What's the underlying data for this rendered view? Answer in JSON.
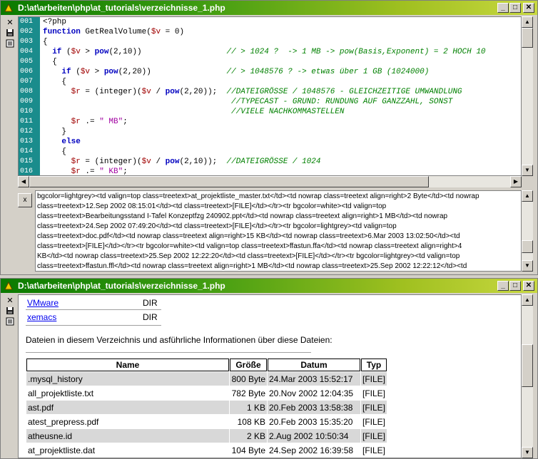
{
  "top_window": {
    "title": "D:\\at\\arbeiten\\php\\at_tutorials\\verzeichnisse_1.php",
    "controls": {
      "minimize": "_",
      "maximize": "□",
      "close": "✕"
    }
  },
  "code_lines": [
    {
      "n": "001",
      "parts": [
        {
          "c": "op",
          "t": "<?php"
        }
      ]
    },
    {
      "n": "002",
      "parts": [
        {
          "c": "kw",
          "t": "function"
        },
        {
          "c": "op",
          "t": " GetRealVolume("
        },
        {
          "c": "var",
          "t": "$v"
        },
        {
          "c": "op",
          "t": " = 0)"
        }
      ]
    },
    {
      "n": "003",
      "parts": [
        {
          "c": "op",
          "t": "{"
        }
      ]
    },
    {
      "n": "004",
      "parts": [
        {
          "c": "op",
          "t": "  "
        },
        {
          "c": "kw",
          "t": "if"
        },
        {
          "c": "op",
          "t": " ("
        },
        {
          "c": "var",
          "t": "$v"
        },
        {
          "c": "op",
          "t": " > "
        },
        {
          "c": "kw",
          "t": "pow"
        },
        {
          "c": "op",
          "t": "(2,10))                  "
        },
        {
          "c": "cm",
          "t": "// > 1024 ?  -> 1 MB -> pow(Basis,Exponent) = 2 HOCH 10"
        }
      ]
    },
    {
      "n": "005",
      "parts": [
        {
          "c": "op",
          "t": "  {"
        }
      ]
    },
    {
      "n": "006",
      "parts": [
        {
          "c": "op",
          "t": "    "
        },
        {
          "c": "kw",
          "t": "if"
        },
        {
          "c": "op",
          "t": " ("
        },
        {
          "c": "var",
          "t": "$v"
        },
        {
          "c": "op",
          "t": " > "
        },
        {
          "c": "kw",
          "t": "pow"
        },
        {
          "c": "op",
          "t": "(2,20))                "
        },
        {
          "c": "cm",
          "t": "// > 1048576 ? -> etwas über 1 GB (1024000)"
        }
      ]
    },
    {
      "n": "007",
      "parts": [
        {
          "c": "op",
          "t": "    {"
        }
      ]
    },
    {
      "n": "008",
      "parts": [
        {
          "c": "op",
          "t": "      "
        },
        {
          "c": "var",
          "t": "$r"
        },
        {
          "c": "op",
          "t": " = (integer)("
        },
        {
          "c": "var",
          "t": "$v"
        },
        {
          "c": "op",
          "t": " / "
        },
        {
          "c": "kw",
          "t": "pow"
        },
        {
          "c": "op",
          "t": "(2,20));  "
        },
        {
          "c": "cm",
          "t": "//DATEIGRÖSSE / 1048576 - GLEICHZEITIGE UMWANDLUNG"
        }
      ]
    },
    {
      "n": "009",
      "parts": [
        {
          "c": "op",
          "t": "                                        "
        },
        {
          "c": "cm",
          "t": "//TYPECAST - GRUND: RUNDUNG AUF GANZZAHL, SONST"
        }
      ]
    },
    {
      "n": "010",
      "parts": [
        {
          "c": "op",
          "t": "                                        "
        },
        {
          "c": "cm",
          "t": "//VIELE NACHKOMMASTELLEN"
        }
      ]
    },
    {
      "n": "011",
      "parts": [
        {
          "c": "op",
          "t": "      "
        },
        {
          "c": "var",
          "t": "$r"
        },
        {
          "c": "op",
          "t": " .= "
        },
        {
          "c": "str",
          "t": "\" MB\""
        },
        {
          "c": "op",
          "t": ";"
        }
      ]
    },
    {
      "n": "012",
      "parts": [
        {
          "c": "op",
          "t": "    }"
        }
      ]
    },
    {
      "n": "013",
      "parts": [
        {
          "c": "op",
          "t": "    "
        },
        {
          "c": "kw",
          "t": "else"
        }
      ]
    },
    {
      "n": "014",
      "parts": [
        {
          "c": "op",
          "t": "    {"
        }
      ]
    },
    {
      "n": "015",
      "parts": [
        {
          "c": "op",
          "t": "      "
        },
        {
          "c": "var",
          "t": "$r"
        },
        {
          "c": "op",
          "t": " = (integer)("
        },
        {
          "c": "var",
          "t": "$v"
        },
        {
          "c": "op",
          "t": " / "
        },
        {
          "c": "kw",
          "t": "pow"
        },
        {
          "c": "op",
          "t": "(2,10));  "
        },
        {
          "c": "cm",
          "t": "//DATEIGRÖSSE / 1024"
        }
      ]
    },
    {
      "n": "016",
      "parts": [
        {
          "c": "op",
          "t": "      "
        },
        {
          "c": "var",
          "t": "$r"
        },
        {
          "c": "op",
          "t": " .= "
        },
        {
          "c": "str",
          "t": "\" KB\""
        },
        {
          "c": "op",
          "t": ";"
        }
      ]
    }
  ],
  "output_close_label": "x",
  "output_lines": [
    "bgcolor=lightgrey><td valign=top class=treetext>at_projektliste_master.txt</td><td nowrap class=treetext align=right>2 Byte</td><td nowrap",
    "class=treetext>12.Sep 2002 08:15:01</td><td class=treetext>[FILE]</td></tr><tr bgcolor=white><td valign=top",
    "class=treetext>Bearbeitungsstand I-Tafel Konzeptfzg 240902.ppt</td><td nowrap class=treetext align=right>1 MB</td><td nowrap",
    "class=treetext>24.Sep 2002 07:49:20</td><td class=treetext>[FILE]</td></tr><tr bgcolor=lightgrey><td valign=top",
    "class=treetext>doc.pdf</td><td nowrap class=treetext align=right>15 KB</td><td nowrap class=treetext>6.Mar 2003 13:02:50</td><td",
    "class=treetext>[FILE]</td></tr><tr bgcolor=white><td valign=top class=treetext>ffastun.ffa</td><td nowrap class=treetext align=right>4",
    "KB</td><td nowrap class=treetext>25.Sep 2002 12:22:20</td><td class=treetext>[FILE]</td></tr><tr bgcolor=lightgrey><td valign=top",
    "class=treetext>ffastun.ffl</td><td nowrap class=treetext align=right>1 MB</td><td nowrap class=treetext>25.Sep 2002 12:22:12</td><td"
  ],
  "bottom_window": {
    "title": "D:\\at\\arbeiten\\php\\at_tutorials\\verzeichnisse_1.php",
    "controls": {
      "minimize": "_",
      "maximize": "□",
      "close": "✕"
    },
    "dirs": [
      {
        "name": "VMware",
        "type": "DIR"
      },
      {
        "name": "xemacs",
        "type": "DIR"
      }
    ],
    "info_text": "Dateien in diesem Verzeichnis und asführliche Informationen über diese Dateien:",
    "table_headers": {
      "name": "Name",
      "size": "Größe",
      "date": "Datum",
      "type": "Typ"
    },
    "files": [
      {
        "name": ".mysql_history",
        "size": "800 Byte",
        "date": "24.Mar 2003 15:52:17",
        "type": "[FILE]"
      },
      {
        "name": "all_projektliste.txt",
        "size": "782 Byte",
        "date": "20.Nov 2002 12:04:35",
        "type": "[FILE]"
      },
      {
        "name": "ast.pdf",
        "size": "1 KB",
        "date": "20.Feb 2003 13:58:38",
        "type": "[FILE]"
      },
      {
        "name": "atest_prepress.pdf",
        "size": "108 KB",
        "date": "20.Feb 2003 15:35:20",
        "type": "[FILE]"
      },
      {
        "name": "atheusne.id",
        "size": "2 KB",
        "date": "2.Aug 2002 10:50:34",
        "type": "[FILE]"
      },
      {
        "name": "at_projektliste.dat",
        "size": "104 Byte",
        "date": "24.Sep 2002 16:39:58",
        "type": "[FILE]"
      }
    ]
  }
}
